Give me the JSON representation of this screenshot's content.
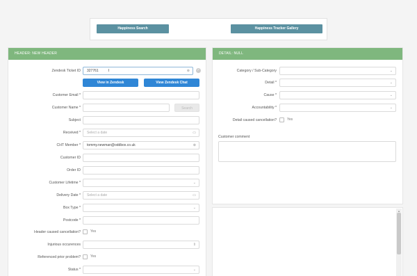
{
  "top_buttons": {
    "happiness_search": "Happiness Search",
    "tracker_gallery": "Happiness Tracker Gallery"
  },
  "left_panel": {
    "header": "HEADER: NEW HEADER",
    "ticket_label": "Zendesk Ticket ID",
    "ticket_value": "327761",
    "view_zendesk": "View in Zendesk",
    "view_chat": "View Zendesk Chat",
    "customer_email": "Customer Email *",
    "customer_name": "Customer Name *",
    "search_button": "Search",
    "subject": "Subject",
    "received": "Received *",
    "received_placeholder": "Select a date",
    "cht_member": "CHT Member *",
    "cht_member_value": "tommy.newman@oddbox.co.uk",
    "customer_id": "Customer ID",
    "order_id": "Order ID",
    "customer_lifetime": "Customer Lifetime *",
    "delivery_date": "Delivery Date *",
    "delivery_placeholder": "Select a date",
    "box_type": "Box Type *",
    "postcode": "Postcode *",
    "header_cancel": "Header caused cancellation?",
    "yes1": "Yes",
    "injurious": "Injurious occurences",
    "referenced": "Referenced prior problem?",
    "yes2": "Yes",
    "status": "Status *"
  },
  "right_panel": {
    "header": "DETAIL: NULL",
    "category": "Category / Sub-Category",
    "detail": "Detail *",
    "cause": "Cause *",
    "accountability": "Accountability *",
    "detail_cancel": "Detail caused cancellation?",
    "yes": "Yes",
    "customer_comment": "Customer comment"
  }
}
